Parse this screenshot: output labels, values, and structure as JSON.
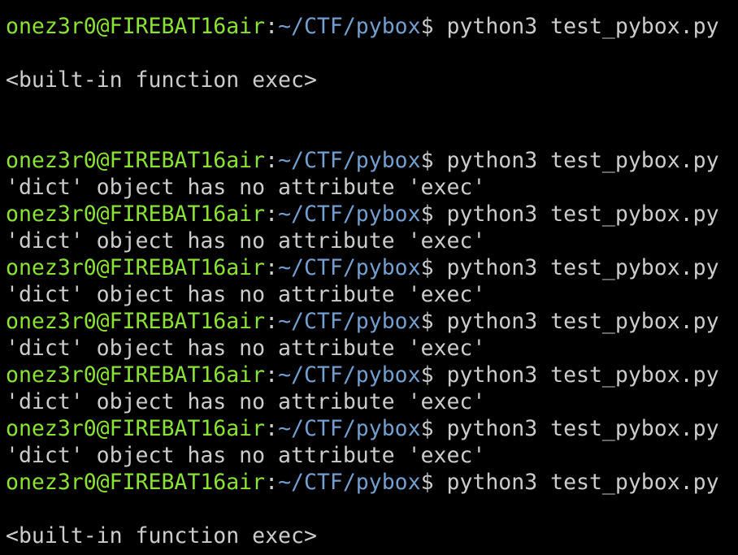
{
  "colors": {
    "background": "#000000",
    "user_host": "#8ae234",
    "path": "#729fcf",
    "text": "#cccccc"
  },
  "prompt": {
    "user_host": "onez3r0@FIREBAT16air",
    "colon": ":",
    "path": "~/CTF/pybox",
    "dollar": "$ "
  },
  "lines": [
    {
      "type": "prompt",
      "command": "python3 test_pybox.py"
    },
    {
      "type": "output",
      "text": ""
    },
    {
      "type": "output",
      "text": "<built-in function exec>"
    },
    {
      "type": "output",
      "text": ""
    },
    {
      "type": "output",
      "text": ""
    },
    {
      "type": "prompt",
      "command": "python3 test_pybox.py"
    },
    {
      "type": "output",
      "text": "'dict' object has no attribute 'exec'"
    },
    {
      "type": "prompt",
      "command": "python3 test_pybox.py"
    },
    {
      "type": "output",
      "text": "'dict' object has no attribute 'exec'"
    },
    {
      "type": "prompt",
      "command": "python3 test_pybox.py"
    },
    {
      "type": "output",
      "text": "'dict' object has no attribute 'exec'"
    },
    {
      "type": "prompt",
      "command": "python3 test_pybox.py"
    },
    {
      "type": "output",
      "text": "'dict' object has no attribute 'exec'"
    },
    {
      "type": "prompt",
      "command": "python3 test_pybox.py"
    },
    {
      "type": "output",
      "text": "'dict' object has no attribute 'exec'"
    },
    {
      "type": "prompt",
      "command": "python3 test_pybox.py"
    },
    {
      "type": "output",
      "text": "'dict' object has no attribute 'exec'"
    },
    {
      "type": "prompt",
      "command": "python3 test_pybox.py"
    },
    {
      "type": "output",
      "text": ""
    },
    {
      "type": "output",
      "text": "<built-in function exec>"
    }
  ]
}
